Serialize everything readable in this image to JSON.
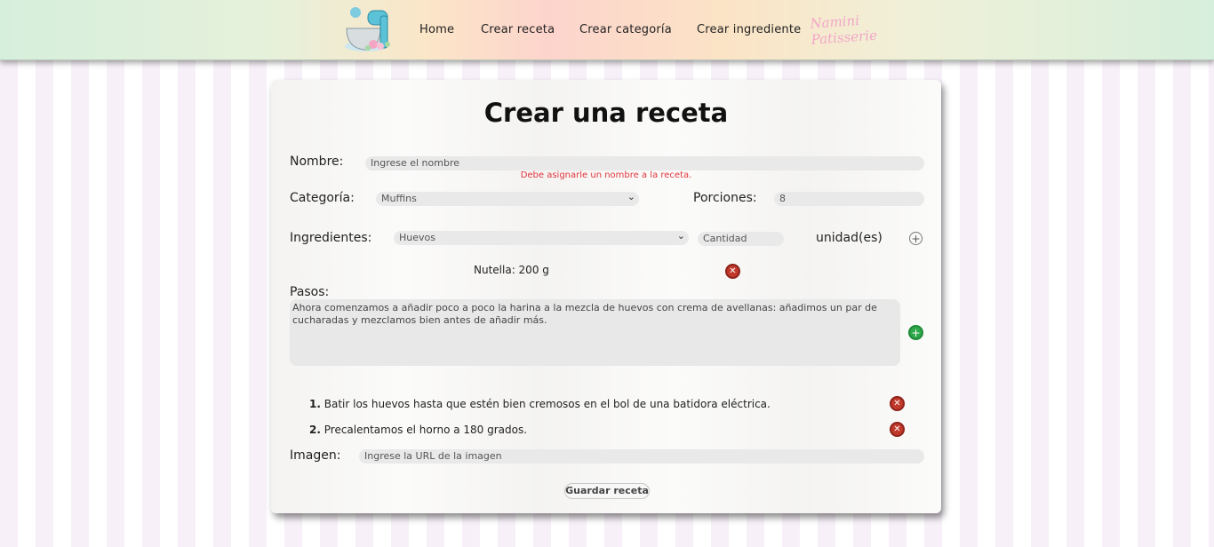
{
  "nav": {
    "links": [
      "Home",
      "Crear receta",
      "Crear categoría",
      "Crear ingrediente"
    ],
    "brand_line1": "Namini",
    "brand_line2": "Patisserie"
  },
  "form": {
    "title": "Crear una receta",
    "name_label": "Nombre:",
    "name_placeholder": "Ingrese el nombre",
    "name_error": "Debe asignarle un nombre a la receta.",
    "category_label": "Categoría:",
    "category_value": "Muffins",
    "portions_label": "Porciones:",
    "portions_value": "8",
    "ingredients_label": "Ingredientes:",
    "ingredient_value": "Huevos",
    "quantity_placeholder": "Cantidad",
    "unit_label": "unidad(es)",
    "ingredient_list": [
      "Nutella: 200 g"
    ],
    "steps_label": "Pasos:",
    "step_text": "Ahora comenzamos a añadir poco a poco la harina a la mezcla de huevos con crema de avellanas: añadimos un par de cucharadas y mezclamos bien antes de añadir más.",
    "steps": [
      {
        "num": "1.",
        "text": "Batir los huevos hasta que estén bien cremosos en el bol de una batidora eléctrica."
      },
      {
        "num": "2.",
        "text": "Precalentamos el horno a 180 grados."
      }
    ],
    "image_label": "Imagen:",
    "image_placeholder": "Ingrese la URL de la imagen",
    "save_label": "Guardar receta"
  },
  "icons": {
    "add_ingredient": "plus-outline-icon",
    "add_step": "plus-green-icon",
    "remove": "x-red-icon"
  },
  "colors": {
    "error": "#e0353b",
    "add_green": "#2ea84a",
    "remove_red": "#c0392b"
  }
}
